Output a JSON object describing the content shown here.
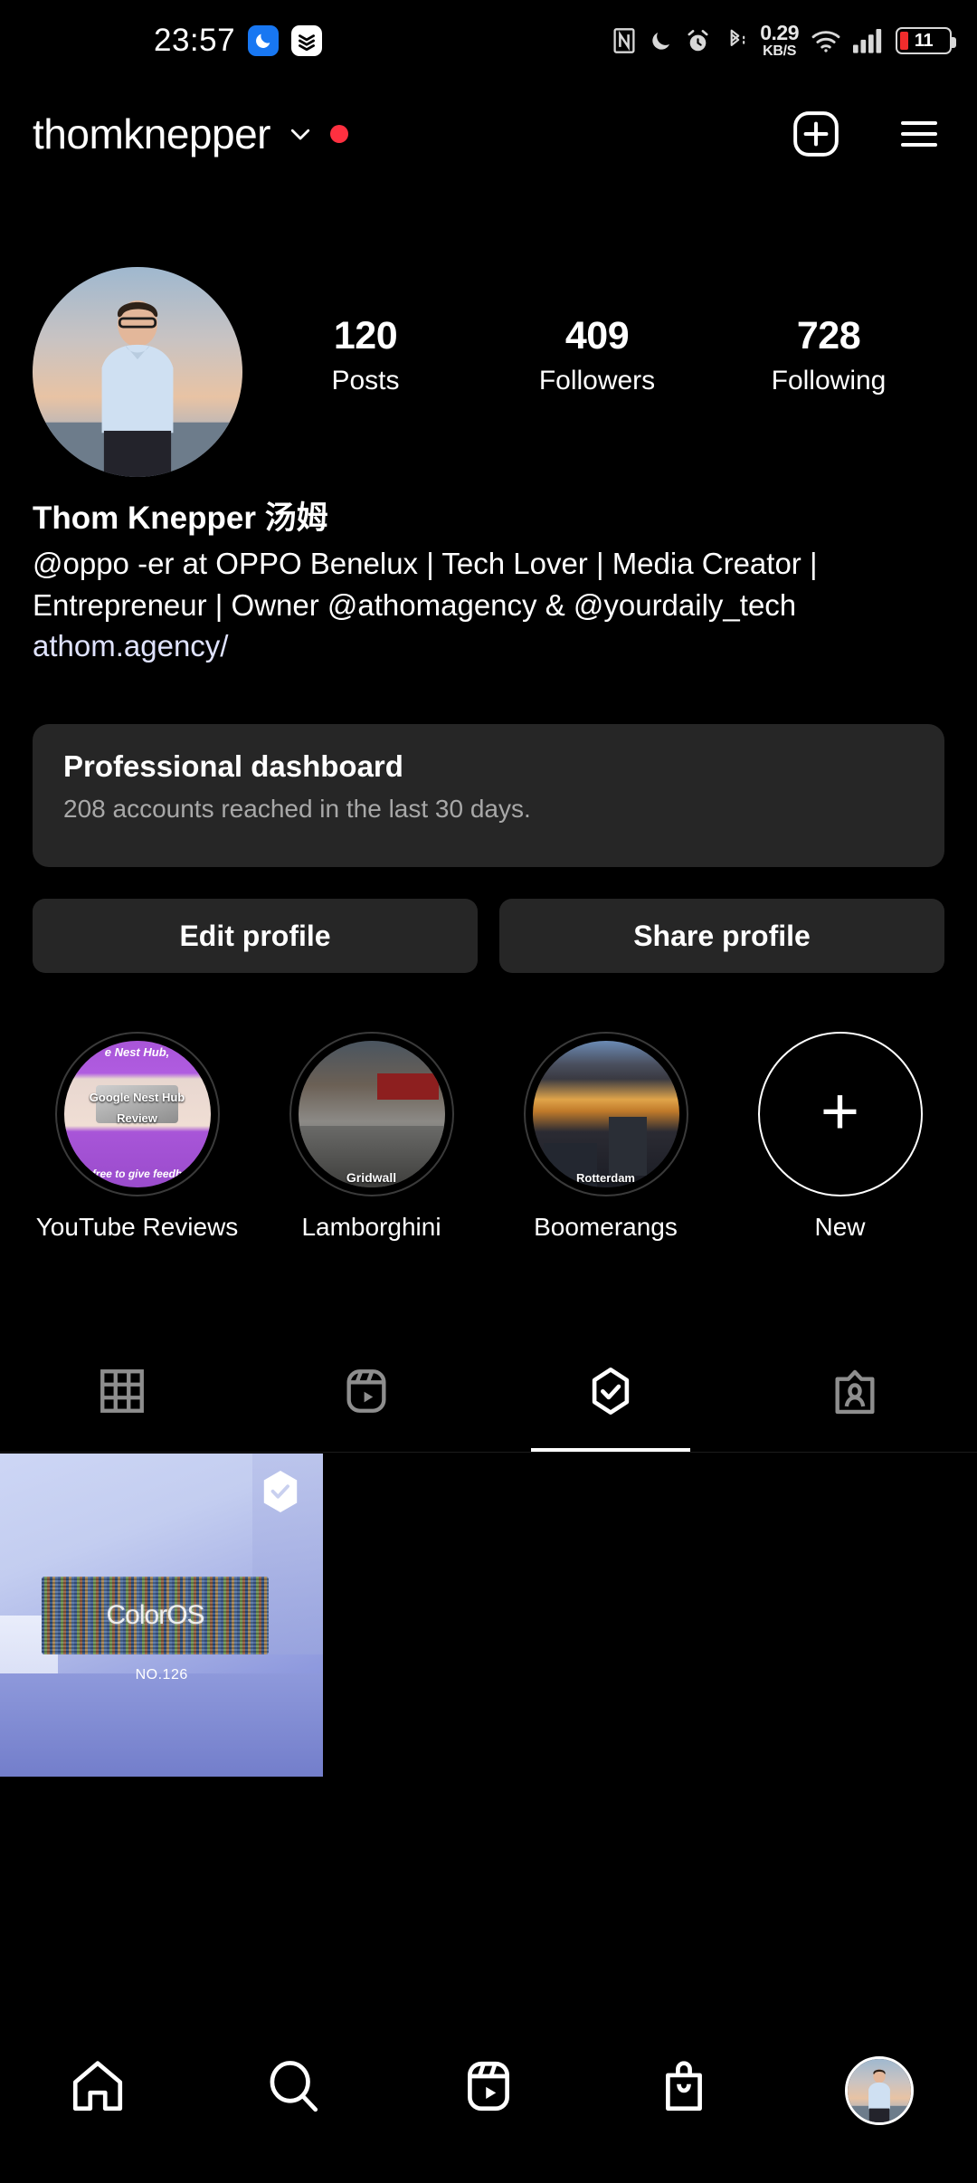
{
  "status_bar": {
    "time": "23:57",
    "app_icons": [
      "sleep-dnd-app-icon",
      "todoist-app-icon"
    ],
    "indicators": [
      "nfc-icon",
      "do-not-disturb-icon",
      "alarm-icon",
      "bluetooth-icon"
    ],
    "network_speed_value": "0.29",
    "network_speed_unit": "KB/S",
    "wifi": "wifi-icon",
    "cellular": "cellular-signal-icon",
    "battery_level": "11",
    "battery_color": "#f02c2c"
  },
  "header": {
    "username": "thomknepper",
    "chevron": "chevron-down-icon",
    "notification_dot_color": "#ff3040",
    "new_post_label": "new-post-icon",
    "menu_label": "hamburger-menu-icon"
  },
  "profile": {
    "avatar": "profile-photo",
    "stats": [
      {
        "num": "120",
        "label": "Posts"
      },
      {
        "num": "409",
        "label": "Followers"
      },
      {
        "num": "728",
        "label": "Following"
      }
    ],
    "display_name": "Thom Knepper 汤姆",
    "bio": "@oppo -er at OPPO Benelux | Tech Lover | Media Creator | Entrepreneur | Owner @athomagency & @yourdaily_tech",
    "link": "athom.agency/",
    "link_color": "#e0e3ff"
  },
  "dashboard": {
    "title": "Professional dashboard",
    "subtitle": "208 accounts reached in the last 30 days."
  },
  "buttons": {
    "edit_profile": "Edit profile",
    "share_profile": "Share profile"
  },
  "highlights": [
    {
      "label": "YouTube Reviews",
      "art": "nest",
      "t1": "e Nest Hub,",
      "t2": "Google Nest Hub",
      "t3": "Review",
      "t4": "free to give feedb"
    },
    {
      "label": "Lamborghini",
      "art": "lambo",
      "caption": "Gridwall"
    },
    {
      "label": "Boomerangs",
      "art": "rdam",
      "caption": "Rotterdam"
    },
    {
      "label": "New",
      "art": "new",
      "plus": "+"
    }
  ],
  "tabs": [
    {
      "name": "grid-tab",
      "icon": "grid-icon",
      "active": false
    },
    {
      "name": "reels-tab",
      "icon": "reels-icon",
      "active": false
    },
    {
      "name": "collabs-tab",
      "icon": "hexagon-check-icon",
      "active": true
    },
    {
      "name": "tagged-tab",
      "icon": "tagged-person-icon",
      "active": false
    }
  ],
  "grid": {
    "posts": [
      {
        "title": "ColorOS",
        "subtitle": "NO.126",
        "badge": "hexagon-check-badge"
      }
    ]
  },
  "bottom_nav": [
    {
      "name": "home",
      "icon": "home-icon",
      "active": false
    },
    {
      "name": "search",
      "icon": "search-icon",
      "active": false
    },
    {
      "name": "reels",
      "icon": "reels-icon",
      "active": false
    },
    {
      "name": "shop",
      "icon": "shop-bag-icon",
      "active": false
    },
    {
      "name": "profile",
      "icon": "avatar-icon",
      "active": true
    }
  ]
}
